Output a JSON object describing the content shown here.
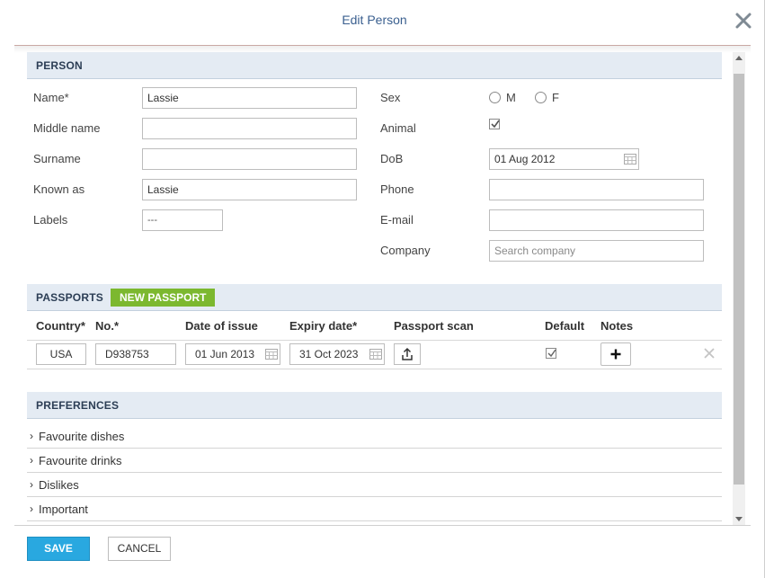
{
  "dialog": {
    "title": "Edit Person",
    "close_icon": "close-icon"
  },
  "person": {
    "section_title": "PERSON",
    "name": {
      "label": "Name*",
      "value": "Lassie"
    },
    "middle_name": {
      "label": "Middle name",
      "value": ""
    },
    "surname": {
      "label": "Surname",
      "value": ""
    },
    "known_as": {
      "label": "Known as",
      "value": "Lassie"
    },
    "labels": {
      "label": "Labels",
      "value": "---"
    },
    "sex": {
      "label": "Sex",
      "options": [
        "M",
        "F"
      ],
      "selected": ""
    },
    "animal": {
      "label": "Animal",
      "checked": true
    },
    "dob": {
      "label": "DoB",
      "value": "01 Aug 2012",
      "icon": "calendar-icon"
    },
    "phone": {
      "label": "Phone",
      "value": ""
    },
    "email": {
      "label": "E-mail",
      "value": ""
    },
    "company": {
      "label": "Company",
      "placeholder": "Search company"
    }
  },
  "passports": {
    "section_title": "PASSPORTS",
    "new_button": "NEW PASSPORT",
    "columns": [
      "Country*",
      "No.*",
      "Date of issue",
      "Expiry date*",
      "Passport scan",
      "Default",
      "Notes"
    ],
    "rows": [
      {
        "country": "USA",
        "number": "D938753",
        "date_of_issue": "01 Jun 2013",
        "expiry_date": "31 Oct 2023",
        "scan_icon": "upload-icon",
        "default": true,
        "notes_icon": "plus-icon",
        "remove_icon": "close-icon"
      }
    ]
  },
  "preferences": {
    "section_title": "PREFERENCES",
    "items": [
      "Favourite dishes",
      "Favourite drinks",
      "Dislikes",
      "Important"
    ]
  },
  "footer": {
    "save_label": "SAVE",
    "cancel_label": "CANCEL"
  },
  "colors": {
    "title": "#3a5f8f",
    "section_bg": "#e4ebf3",
    "new_button_bg": "#7cb82f",
    "save_bg": "#29a8e0"
  }
}
